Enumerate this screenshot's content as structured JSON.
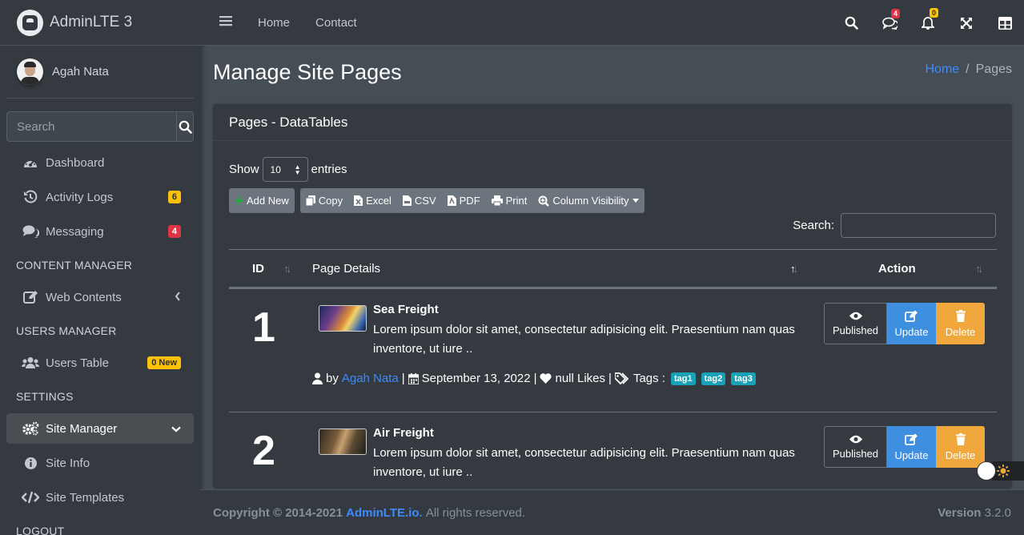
{
  "brand": {
    "name": "AdminLTE 3"
  },
  "user": {
    "name": "Agah Nata"
  },
  "sidebar_search": {
    "placeholder": "Search"
  },
  "sidebar": {
    "dashboard": "Dashboard",
    "activity_logs": "Activity Logs",
    "activity_badge": "6",
    "messaging": "Messaging",
    "messaging_badge": "4",
    "header_content": "CONTENT MANAGER",
    "web_contents": "Web Contents",
    "header_users": "USERS MANAGER",
    "users_table": "Users Table",
    "users_badge": "0 New",
    "header_settings": "SETTINGS",
    "site_manager": "Site Manager",
    "site_info": "Site Info",
    "site_templates": "Site Templates",
    "logout": "LOGOUT"
  },
  "topbar": {
    "home": "Home",
    "contact": "Contact",
    "messages_badge": "4",
    "notifications_badge": "0"
  },
  "page": {
    "title": "Manage Site Pages",
    "breadcrumb_home": "Home",
    "breadcrumb_sep": "/",
    "breadcrumb_current": "Pages"
  },
  "card": {
    "title": "Pages - DataTables",
    "show_label": "Show",
    "entries_value": "10",
    "entries_label": "entries",
    "search_label": "Search:",
    "buttons": {
      "add_new": "Add New",
      "copy": "Copy",
      "excel": "Excel",
      "csv": "CSV",
      "pdf": "PDF",
      "print": "Print",
      "column_visibility": "Column Visibility"
    },
    "columns": {
      "id": "ID",
      "details": "Page Details",
      "action": "Action"
    }
  },
  "rows": [
    {
      "id": "1",
      "title": "Sea Freight",
      "description": "Lorem ipsum dolor sit amet, consectetur adipisicing elit. Praesentium nam quas inventore, ut iure ..",
      "by": "by",
      "author": "Agah Nata",
      "date": "September 13, 2022",
      "likes": "null Likes",
      "tags_label": "Tags :",
      "tags": [
        "tag1",
        "tag2",
        "tag3"
      ],
      "published": "Published",
      "update": "Update",
      "delete": "Delete"
    },
    {
      "id": "2",
      "title": "Air Freight",
      "description": "Lorem ipsum dolor sit amet, consectetur adipisicing elit. Praesentium nam quas inventore, ut iure ..",
      "published": "Published",
      "update": "Update",
      "delete": "Delete"
    }
  ],
  "footer": {
    "copyright": "Copyright © 2014-2021",
    "link": "AdminLTE.io.",
    "rights": "All rights reserved.",
    "version_label": "Version",
    "version": "3.2.0"
  },
  "colors": {
    "sidebar_bg": "#343a40",
    "content_bg": "#454d55",
    "primary": "#3d8bfd",
    "warning": "#ffc107",
    "danger": "#dc3545",
    "info": "#17a2b8"
  }
}
